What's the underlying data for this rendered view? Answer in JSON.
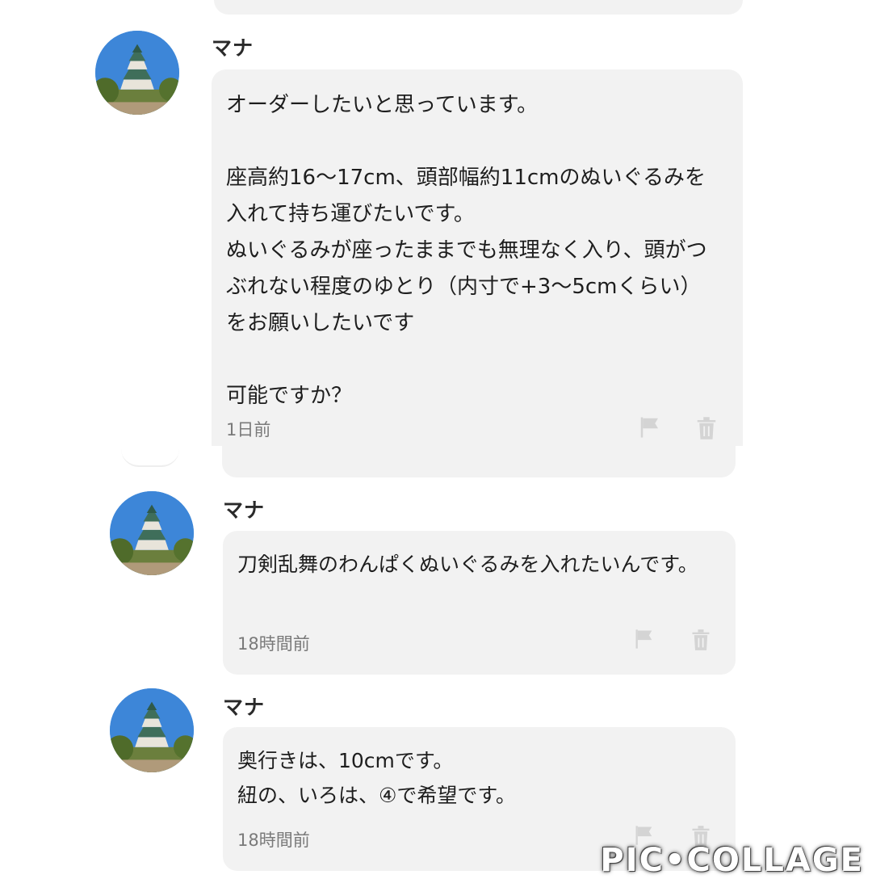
{
  "messages": [
    {
      "sender": "マナ",
      "text": "オーダーしたいと思っています。\n\n座高約16〜17cm、頭部幅約11cmのぬいぐるみを入れて持ち運びたいです。\nぬいぐるみが座ったままでも無理なく入り、頭がつぶれない程度のゆとり（内寸で+3〜5cmくらい）をお願いしたいです\n\n可能ですか？",
      "time": "1日前"
    },
    {
      "sender": "マナ",
      "text": "刀剣乱舞のわんぱくぬいぐるみを入れたいんです。",
      "time": "18時間前"
    },
    {
      "sender": "マナ",
      "text": "奥行きは、10cmです。\n紐の、いろは、④で希望です。",
      "time": "18時間前"
    }
  ],
  "icons": {
    "report": "flag-icon",
    "delete": "trash-icon"
  },
  "watermark": "PIC•COLLAGE"
}
